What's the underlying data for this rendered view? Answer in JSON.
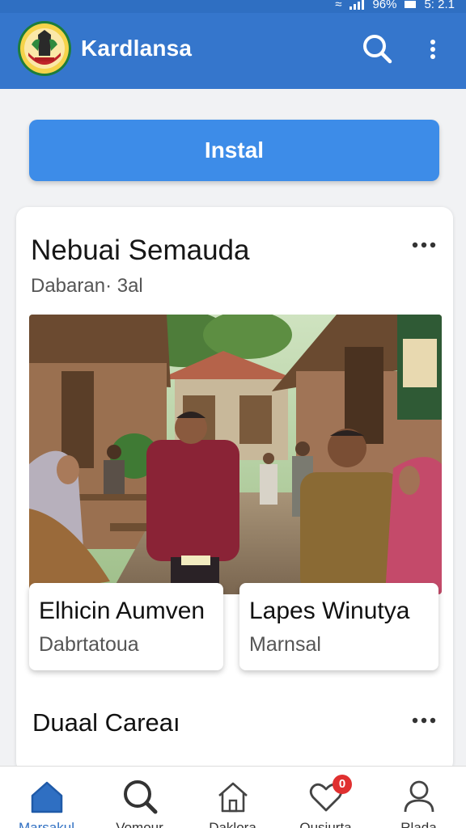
{
  "status_bar": {
    "battery": "96%",
    "time": "5: 2.1"
  },
  "app_bar": {
    "title": "Kardlansa"
  },
  "install_button": {
    "label": "Instal"
  },
  "feed_card": {
    "title": "Nebuai Semauda",
    "subtitle": "Dabaran· 3al",
    "items": [
      {
        "title": "Elhicin Aumven",
        "subtitle": "Dabrtatoua"
      },
      {
        "title": "Lapes Winutya",
        "subtitle": "Marnsal"
      }
    ]
  },
  "second_card": {
    "title": "Duaal Careaı"
  },
  "bottom_nav": {
    "items": [
      {
        "label": "Marsakul",
        "icon": "home-icon",
        "active": true
      },
      {
        "label": "Vomour",
        "icon": "search-icon"
      },
      {
        "label": "Daklora",
        "icon": "house-outline-icon"
      },
      {
        "label": "Qusiurta",
        "icon": "heart-icon",
        "badge": "0"
      },
      {
        "label": "Rlada",
        "icon": "profile-icon"
      }
    ]
  },
  "colors": {
    "app_bar": "#3576cc",
    "accent": "#3d8ce8",
    "badge": "#e03030"
  }
}
